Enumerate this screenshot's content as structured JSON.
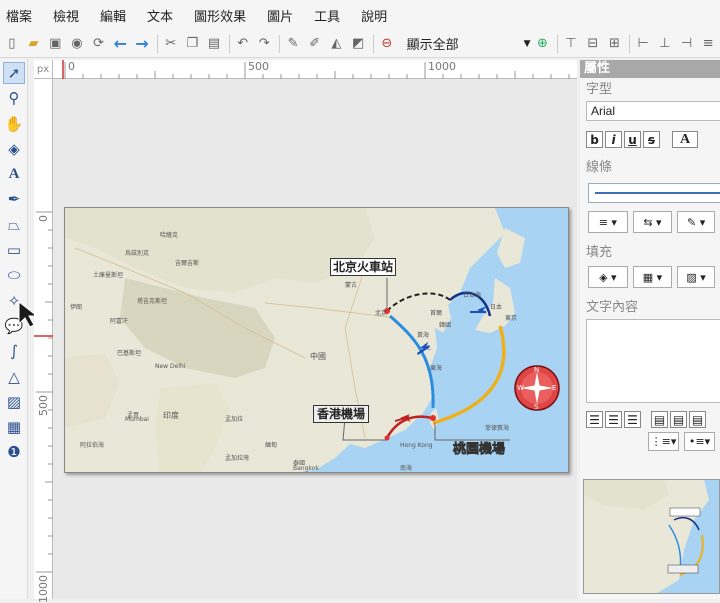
{
  "menu": [
    "檔案",
    "檢視",
    "編輯",
    "文本",
    "圖形效果",
    "圖片",
    "工具",
    "說明"
  ],
  "toolbar": {
    "zoom_value": "顯示全部"
  },
  "ruler": {
    "unit": "px",
    "top_marks": [
      "0",
      "500",
      "1000"
    ],
    "left_marks": [
      "0",
      "500",
      "1000"
    ]
  },
  "map": {
    "label_beijing": "北京火車站",
    "label_hongkong": "香港機場",
    "label_taoyuan": "桃園機場",
    "compass": [
      "N",
      "S",
      "W",
      "E"
    ],
    "places": [
      {
        "name": "中國"
      },
      {
        "name": "韓國"
      },
      {
        "name": "日本"
      },
      {
        "name": "印度"
      },
      {
        "name": "蒙古"
      },
      {
        "name": "哈薩克"
      },
      {
        "name": "伊朗"
      },
      {
        "name": "阿富汗"
      },
      {
        "name": "巴基斯坦"
      },
      {
        "name": "緬甸"
      },
      {
        "name": "烏茲別克"
      },
      {
        "name": "土庫曼斯坦"
      },
      {
        "name": "吉爾吉斯"
      },
      {
        "name": "塔吉克斯坦"
      },
      {
        "name": "New Delhi"
      },
      {
        "name": "孟加拉"
      },
      {
        "name": "泰國"
      },
      {
        "name": "Bangkok"
      },
      {
        "name": "Hong Kong"
      },
      {
        "name": "Mumbai"
      },
      {
        "name": "孟買"
      },
      {
        "name": "北京"
      },
      {
        "name": "首爾"
      },
      {
        "name": "東京"
      },
      {
        "name": "黃海"
      },
      {
        "name": "東海"
      },
      {
        "name": "日本海"
      },
      {
        "name": "菲律賓海"
      },
      {
        "name": "阿拉伯海"
      },
      {
        "name": "孟加拉灣"
      },
      {
        "name": "南海"
      }
    ]
  },
  "panel": {
    "title": "屬性",
    "font_label": "字型",
    "font_value": "Arial",
    "format_buttons": [
      "b",
      "i",
      "u",
      "s"
    ],
    "color_button": "A",
    "line_label": "線條",
    "fill_label": "填充",
    "text_label": "文字內容"
  },
  "colors": {
    "title_bar": "#a8a8a8",
    "accent_blue": "#2f7fd8",
    "ruler_marker": "#d23030"
  }
}
